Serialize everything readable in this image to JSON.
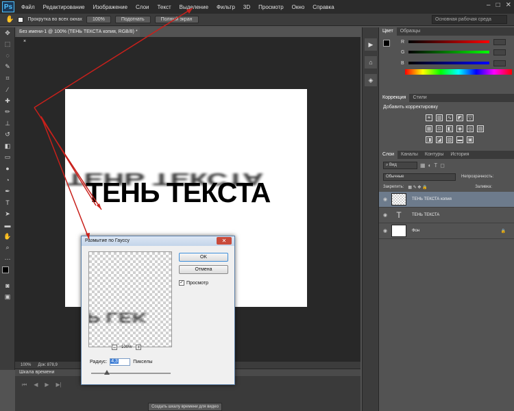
{
  "menubar": {
    "logo": "Ps",
    "items": [
      "Файл",
      "Редактирование",
      "Изображение",
      "Слои",
      "Текст",
      "Выделение",
      "Фильтр",
      "3D",
      "Просмотр",
      "Окно",
      "Справка"
    ],
    "window_buttons": [
      "–",
      "□",
      "✕"
    ]
  },
  "options": {
    "scroll_all_label": "Прокрутка во всех окнах",
    "zoom_btn": "100%",
    "fit_btn": "Подогнать",
    "fullscreen_btn": "Полный экран",
    "workspace": "Основная рабочая среда"
  },
  "document": {
    "tab_title": "Без имени-1 @ 100% (ТЕНЬ ТЕКСТА копия, RGB/8) *",
    "main_text": "ТЕНЬ ТЕКСТА",
    "shadow_text": "ТЕНЬ ТЕКСТА"
  },
  "status": {
    "zoom": "100%",
    "doc_info": "Док: 878,9"
  },
  "timeline": {
    "title": "Шкала времени",
    "create_button": "Создать шкалу времени для видео"
  },
  "panels": {
    "color_tabs": [
      "Цвет",
      "Образцы"
    ],
    "channels": [
      "R",
      "G",
      "B"
    ],
    "adjust_tabs": [
      "Коррекция",
      "Стили"
    ],
    "adjust_title": "Добавить корректировку",
    "layers_tabs": [
      "Слои",
      "Каналы",
      "Контуры",
      "История"
    ],
    "kind_filter": "Вид",
    "blend_mode": "Обычные",
    "opacity_label": "Непрозрачность:",
    "lock_label": "Закрепить:",
    "fill_label": "Заливка:",
    "layers": [
      {
        "name": "ТЕНЬ ТЕКСТА копия",
        "thumb": "",
        "active": true
      },
      {
        "name": "ТЕНЬ ТЕКСТА",
        "thumb": "T",
        "active": false
      },
      {
        "name": "Фон",
        "thumb": "",
        "active": false
      }
    ]
  },
  "dialog": {
    "title": "Размытие по Гауссу",
    "ok": "OK",
    "cancel": "Отмена",
    "preview_label": "Просмотр",
    "zoom_minus": "–",
    "zoom_value": "100%",
    "zoom_plus": "+",
    "radius_label": "Радиус:",
    "radius_value": "4,3",
    "radius_unit": "Пикселы",
    "radius_slider_fraction": 0.2,
    "preview_text": "Р LEK"
  },
  "colors": {
    "arrow": "#c8201b",
    "ps_blue": "#4fc1ff",
    "dialog_accent": "#3c8dd9"
  }
}
